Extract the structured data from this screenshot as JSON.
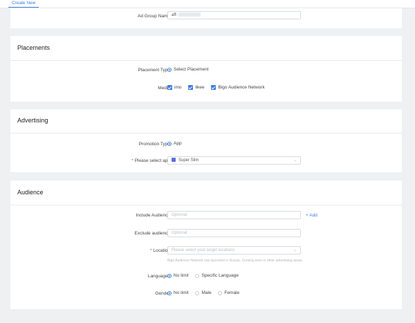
{
  "tabs": {
    "create_new": "Create New"
  },
  "ad_group": {
    "label": "Ad Group Name",
    "value": "aff-"
  },
  "placements": {
    "title": "Placements",
    "placement_type_label": "Placement Type",
    "placement_type_value": "Select Placement",
    "media_label": "Media",
    "media_options": [
      "imo",
      "likee",
      "Bigo Audience Network"
    ]
  },
  "advertising": {
    "title": "Advertising",
    "promotion_type_label": "Promotion Type",
    "promotion_type_value": "App",
    "select_app_label": "Please select app",
    "select_app_value": "Super Slim"
  },
  "audience": {
    "title": "Audience",
    "include_label": "Include Audience",
    "include_placeholder": "Optional",
    "add_label": "+ Add",
    "exclude_label": "Exclude audience",
    "exclude_placeholder": "Optional",
    "location_label": "Location",
    "location_placeholder": "Please select your target locations",
    "location_hint": "Bigo Audience Network has launched in Russia. Coming soon in other advertising areas.",
    "languages_label": "Languages",
    "languages_options": [
      "No limit",
      "Specific Language"
    ],
    "gender_label": "Gender",
    "gender_options": [
      "No limit",
      "Male",
      "Female"
    ]
  },
  "colors": {
    "accent": "#3b7ddd",
    "required": "#e84a5f",
    "background": "#eef0f2"
  }
}
